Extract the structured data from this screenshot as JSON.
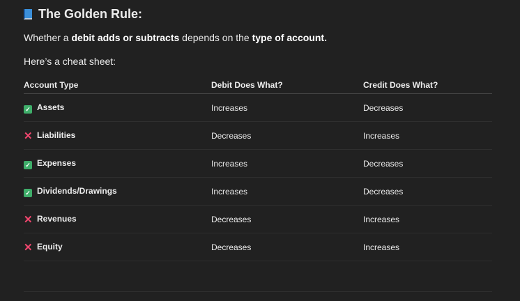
{
  "title": "The Golden Rule:",
  "intro": {
    "pre": "Whether a ",
    "b1": "debit adds or subtracts",
    "mid": " depends on the ",
    "b2": "type of account."
  },
  "cheat": "Here’s a cheat sheet:",
  "headers": [
    "Account Type",
    "Debit Does What?",
    "Credit Does What?"
  ],
  "rows": [
    {
      "icon": "check",
      "name": "Assets",
      "debit": "Increases",
      "credit": "Decreases"
    },
    {
      "icon": "cross",
      "name": "Liabilities",
      "debit": "Decreases",
      "credit": "Increases"
    },
    {
      "icon": "check",
      "name": "Expenses",
      "debit": "Increases",
      "credit": "Decreases"
    },
    {
      "icon": "check",
      "name": "Dividends/Drawings",
      "debit": "Increases",
      "credit": "Decreases"
    },
    {
      "icon": "cross",
      "name": "Revenues",
      "debit": "Decreases",
      "credit": "Increases"
    },
    {
      "icon": "cross",
      "name": "Equity",
      "debit": "Decreases",
      "credit": "Increases"
    }
  ]
}
